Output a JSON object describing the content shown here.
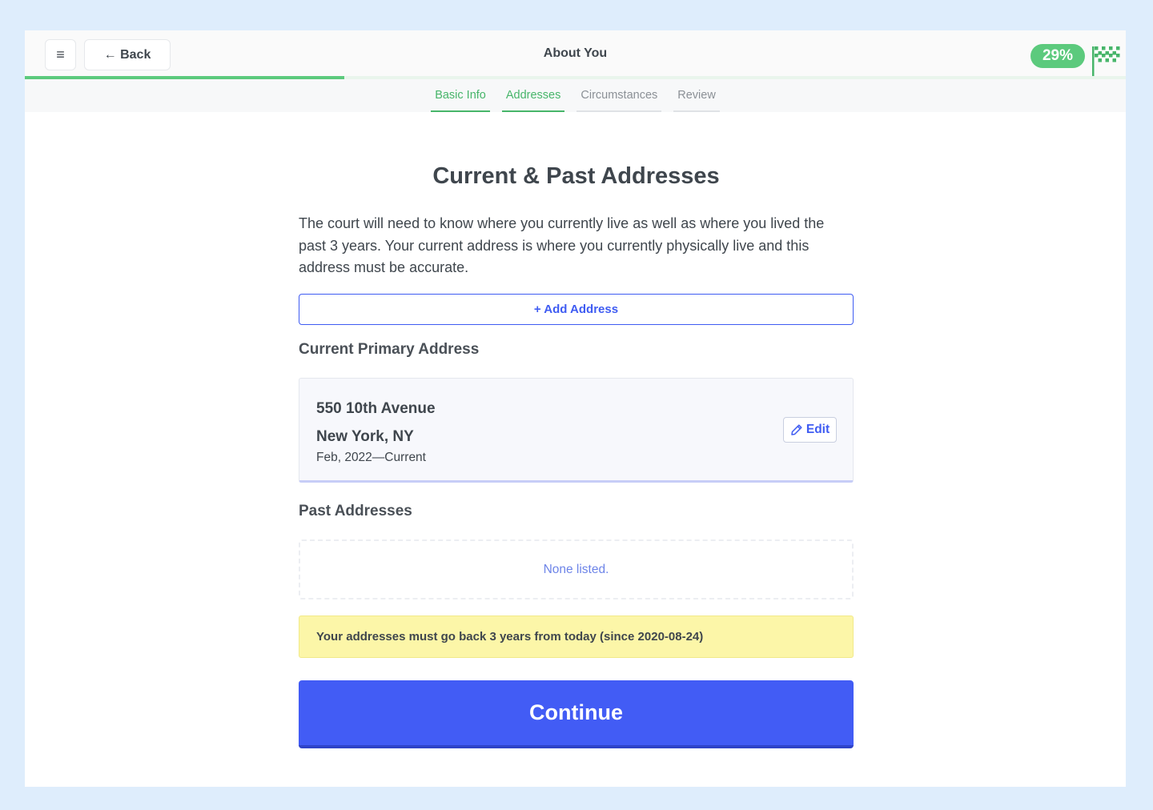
{
  "header": {
    "menu_icon": "hamburger-menu-icon",
    "back_label": "← Back",
    "title": "About You",
    "progress_percent": 29,
    "progress_label": "29%",
    "finish_icon": "checkered-flag-icon"
  },
  "tabs": [
    {
      "label": "Basic Info",
      "state": "done"
    },
    {
      "label": "Addresses",
      "state": "done"
    },
    {
      "label": "Circumstances",
      "state": "pending"
    },
    {
      "label": "Review",
      "state": "pending"
    }
  ],
  "main": {
    "heading": "Current & Past Addresses",
    "intro": "The court will need to know where you currently live as well as where you lived the past 3 years. Your current address is where you currently physically live and this address must be accurate.",
    "add_button_label": "+ Add Address",
    "current_section_label": "Current Primary Address",
    "current_address": {
      "line1": "550 10th Avenue",
      "line2": "New York, NY",
      "dates": "Feb, 2022—Current",
      "edit_label": "Edit",
      "edit_icon": "pencil-icon"
    },
    "past_section_label": "Past Addresses",
    "past_empty_text": "None listed.",
    "warning_text": "Your addresses must go back 3 years from today (since 2020-08-24)",
    "continue_label": "Continue"
  },
  "colors": {
    "accent_blue": "#425cf5",
    "success_green": "#5cca7d",
    "warning_yellow": "#fcf6a8",
    "page_background": "#deedfc"
  }
}
